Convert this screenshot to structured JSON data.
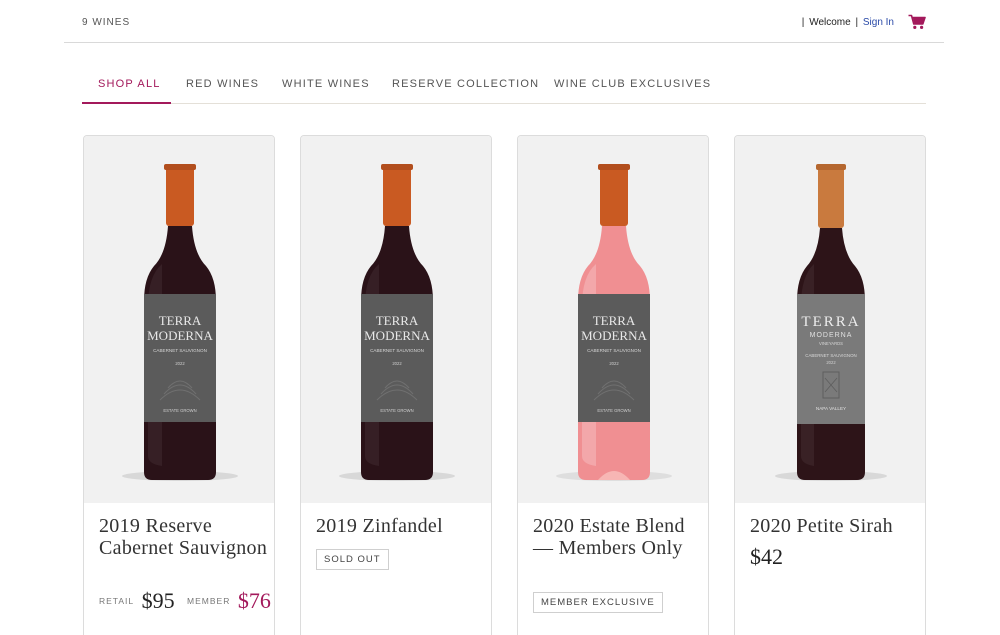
{
  "header": {
    "wine_count": "9 WINES",
    "welcome": "Welcome",
    "sign_in": "Sign In",
    "cart_icon": "cart-icon"
  },
  "tabs": [
    {
      "label": "SHOP ALL",
      "active": true
    },
    {
      "label": "RED WINES",
      "active": false
    },
    {
      "label": "WHITE WINES",
      "active": false
    },
    {
      "label": "RESERVE COLLECTION",
      "active": false
    },
    {
      "label": "WINE CLUB EXCLUSIVES",
      "active": false
    }
  ],
  "colors": {
    "accent": "#a3195b",
    "link": "#2a4aa8",
    "red_wine": "#2a1218",
    "rose_wine": "#f08f92",
    "capsule": "#c95a22",
    "label": "#5b5b5b"
  },
  "products": [
    {
      "name": "2019 Reserve Cabernet Sauvignon",
      "label_brand_1": "TERRA",
      "label_brand_2": "MODERNA",
      "label_varietal": "CABERNET SAUVIGNON",
      "label_year": "2022",
      "label_footer": "ESTATE GROWN",
      "retail_label": "RETAIL",
      "retail_price": "$95",
      "member_label": "MEMBER",
      "member_price": "$76"
    },
    {
      "name": "2019 Zinfandel",
      "label_brand_1": "TERRA",
      "label_brand_2": "MODERNA",
      "label_varietal": "CABERNET SAUVIGNON",
      "label_year": "2022",
      "label_footer": "ESTATE GROWN",
      "badge": "SOLD OUT"
    },
    {
      "name": "2020 Estate Blend — Members Only",
      "label_brand_1": "TERRA",
      "label_brand_2": "MODERNA",
      "label_varietal": "CABERNET SAUVIGNON",
      "label_year": "2022",
      "label_footer": "ESTATE GROWN",
      "badge": "MEMBER EXCLUSIVE"
    },
    {
      "name": "2020 Petite Sirah",
      "label_brand_1": "TERRA",
      "label_brand_2": "MODERNA",
      "label_sub": "VINEYARDS",
      "label_varietal": "CABERNET SAUVIGNON",
      "label_year": "2022",
      "label_footer": "NAPA VALLEY",
      "price": "$42"
    }
  ]
}
